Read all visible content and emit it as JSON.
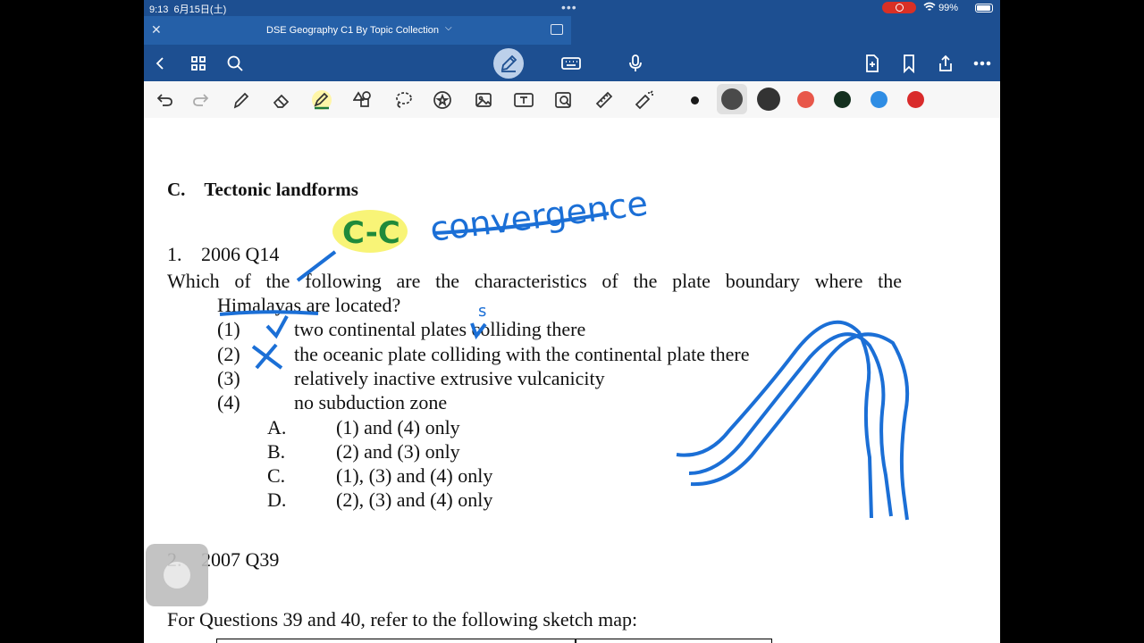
{
  "status": {
    "time": "9:13",
    "date": "6月15日(土)",
    "battery": "99%"
  },
  "tab": {
    "title": "DSE Geography C1 By Topic Collection"
  },
  "navbar": {
    "left": [
      "back-icon",
      "grid-icon",
      "search-icon"
    ],
    "center": [
      "pen-mode-icon",
      "keyboard-icon",
      "microphone-icon"
    ],
    "right": [
      "add-page-icon",
      "bookmark-icon",
      "share-icon",
      "more-icon"
    ]
  },
  "toolbar": {
    "tools": [
      "undo-icon",
      "redo-icon",
      "pen-icon",
      "eraser-icon",
      "highlighter-icon",
      "shapes-icon",
      "lasso-icon",
      "sticker-icon",
      "image-icon",
      "textbox-icon",
      "zoom-icon",
      "ruler-icon",
      "laser-pointer-icon"
    ],
    "colors": [
      "#1a1a1a",
      "#4a4a4a",
      "#333333",
      "#e8574a",
      "#14301f",
      "#2f8de4",
      "#d92b2b"
    ]
  },
  "document": {
    "section": "C. Tectonic landforms",
    "q1_num": "1.",
    "q1_src": "2006 Q14",
    "q1_text_line1": "Which of the following are the characteristics of the plate boundary where the",
    "q1_text_line2": "Himalayas are located?",
    "options": [
      {
        "num": "(1)",
        "text": "two continental plates colliding there"
      },
      {
        "num": "(2)",
        "text": "the oceanic plate colliding with the continental plate there"
      },
      {
        "num": "(3)",
        "text": "relatively inactive extrusive vulcanicity"
      },
      {
        "num": "(4)",
        "text": "no subduction zone"
      }
    ],
    "answers": [
      {
        "letter": "A.",
        "text": "(1) and (4) only"
      },
      {
        "letter": "B.",
        "text": "(2) and (3) only"
      },
      {
        "letter": "C.",
        "text": "(1), (3) and (4) only"
      },
      {
        "letter": "D.",
        "text": "(2), (3) and (4) only"
      }
    ],
    "q2_num": "2.",
    "q2_src": "2007 Q39",
    "q2_intro": "For Questions 39 and 40, refer to the following sketch map:"
  },
  "annotations": {
    "highlight_text": "C-C",
    "handwritten": "convergence",
    "mark_s": "s"
  }
}
